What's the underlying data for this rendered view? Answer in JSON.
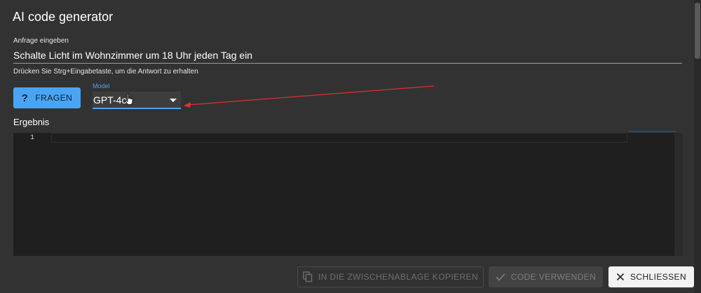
{
  "dialog": {
    "title": "AI code generator"
  },
  "query": {
    "label": "Anfrage eingeben",
    "value": "Schalte Licht im Wohnzimmer um 18 Uhr jeden Tag ein",
    "hint": "Drücken Sie Strg+Eingabetaste, um die Antwort zu erhalten"
  },
  "ask_button": {
    "icon": "question-mark-icon",
    "label": "FRAGEN"
  },
  "model": {
    "label": "Model",
    "value": "GPT-4o"
  },
  "result": {
    "label": "Ergebnis",
    "line_numbers": [
      "1"
    ],
    "code": ""
  },
  "footer": {
    "copy_label": "IN DIE ZWISCHENABLAGE KOPIEREN",
    "use_label": "CODE VERWENDEN",
    "close_label": "SCHLIESSEN"
  },
  "colors": {
    "accent": "#49a5f4",
    "annotation": "#e03030",
    "background": "#323232",
    "editor_bg": "#1f1f1f"
  }
}
